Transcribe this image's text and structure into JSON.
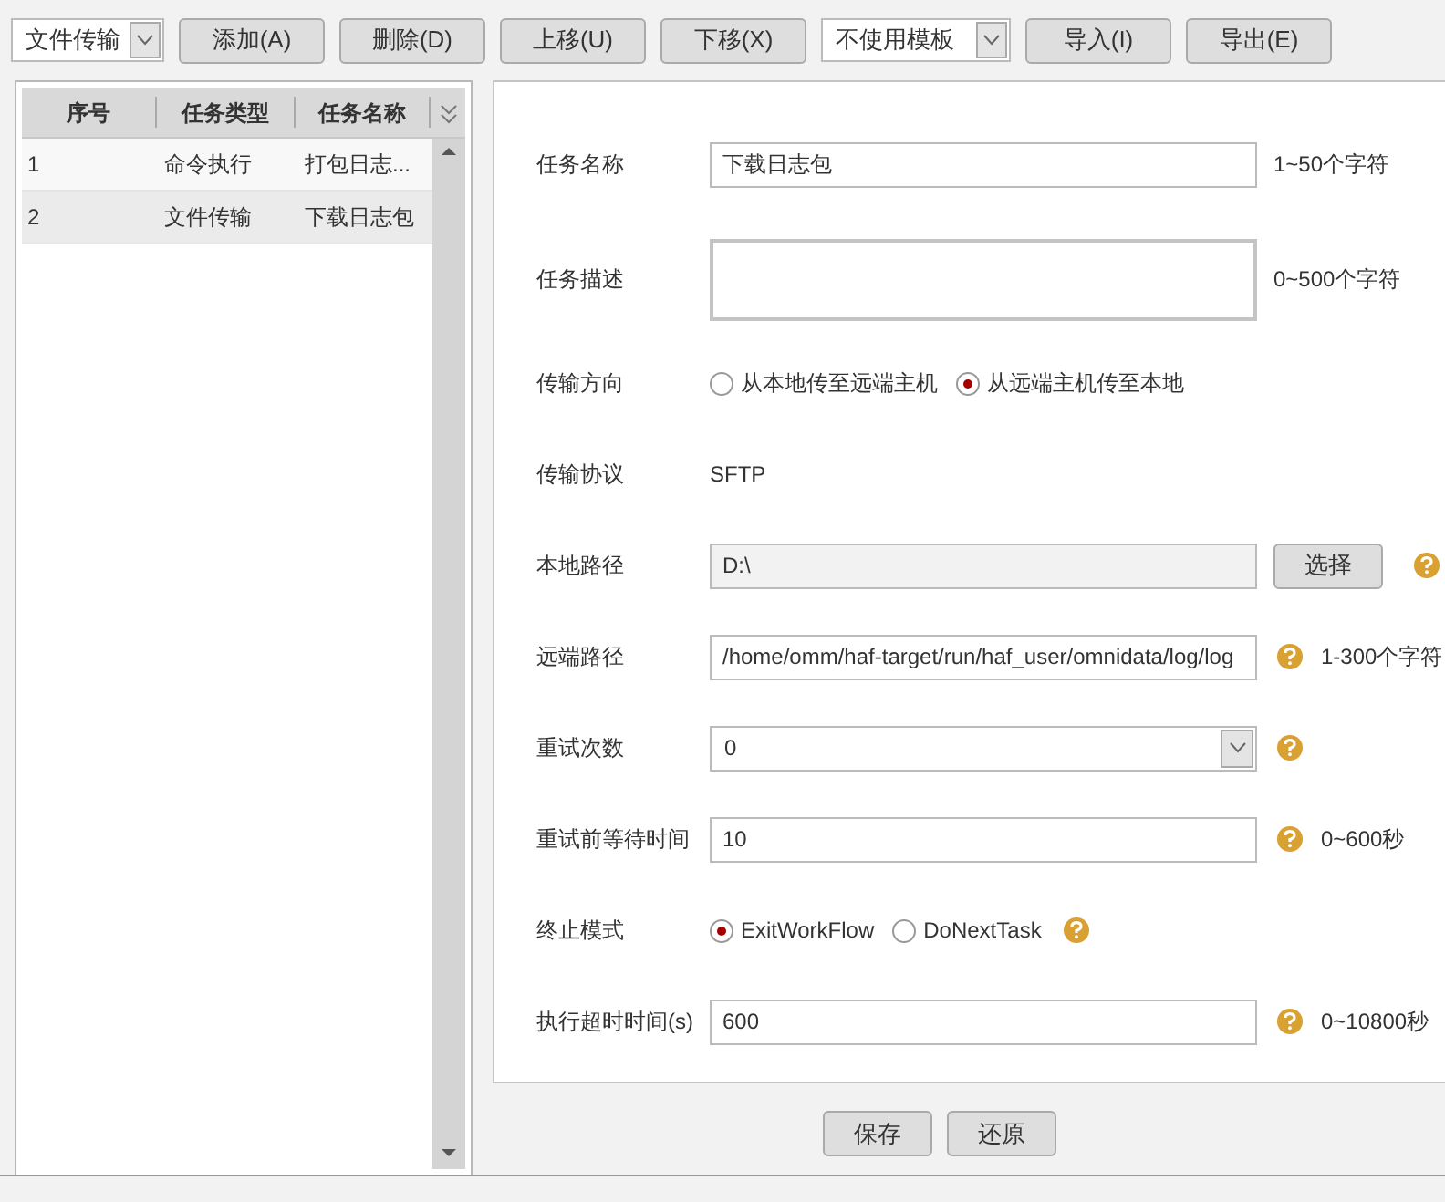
{
  "toolbar": [
    {
      "kind": "select",
      "value": "文件传输"
    },
    {
      "kind": "button",
      "label": "添加(A)"
    },
    {
      "kind": "button",
      "label": "删除(D)"
    },
    {
      "kind": "button",
      "label": "上移(U)"
    },
    {
      "kind": "button",
      "label": "下移(X)"
    },
    {
      "kind": "select",
      "value": "不使用模板"
    },
    {
      "kind": "button",
      "label": "导入(I)"
    },
    {
      "kind": "button",
      "label": "导出(E)"
    }
  ],
  "task_table": {
    "columns": [
      "序号",
      "任务类型",
      "任务名称"
    ],
    "rows": [
      {
        "cells": [
          "1",
          "命令执行",
          "打包日志..."
        ],
        "selected": false
      },
      {
        "cells": [
          "2",
          "文件传输",
          "下载日志包"
        ],
        "selected": true
      }
    ]
  },
  "form": {
    "fields": [
      {
        "kind": "text",
        "label": "任务名称",
        "value": "下载日志包",
        "hint": "1~50个字符",
        "help": false
      },
      {
        "kind": "textarea",
        "label": "任务描述",
        "hint": "0~500个字符",
        "help": false
      },
      {
        "kind": "radio",
        "label": "传输方向",
        "options": [
          {
            "label": "从本地传至远端主机",
            "selected": false
          },
          {
            "label": "从远端主机传至本地",
            "selected": true
          }
        ],
        "help": false
      },
      {
        "kind": "static",
        "label": "传输协议",
        "value": "SFTP",
        "help": false
      },
      {
        "kind": "text",
        "label": "本地路径",
        "value": "D:\\",
        "disabled": true,
        "button": "选择",
        "help": true
      },
      {
        "kind": "text",
        "label": "远端路径",
        "value": "/home/omm/haf-target/run/haf_user/omnidata/log/log",
        "hint": "1-300个字符",
        "help": true
      },
      {
        "kind": "select",
        "label": "重试次数",
        "value": "0",
        "help": true
      },
      {
        "kind": "text",
        "label": "重试前等待时间",
        "value": "10",
        "hint": "0~600秒",
        "help": true
      },
      {
        "kind": "radio",
        "label": "终止模式",
        "options": [
          {
            "label": "ExitWorkFlow",
            "selected": true
          },
          {
            "label": "DoNextTask",
            "selected": false
          }
        ],
        "help": true
      },
      {
        "kind": "text",
        "label": "执行超时时间(s)",
        "value": "600",
        "hint": "0~10800秒",
        "help": true
      }
    ]
  },
  "footer_buttons": [
    "保存",
    "还原"
  ]
}
